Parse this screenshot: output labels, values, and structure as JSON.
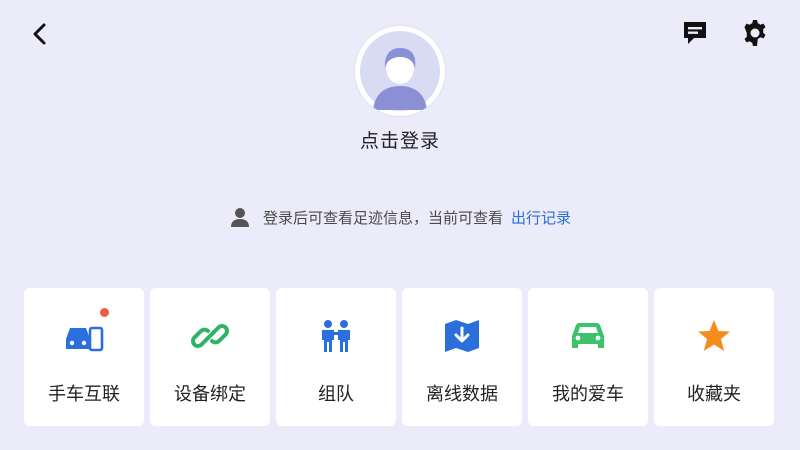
{
  "header": {
    "back_icon": "chevron-left-icon",
    "message_icon": "message-icon",
    "settings_icon": "gear-icon"
  },
  "profile": {
    "avatar_icon": "default-avatar-icon",
    "login_label": "点击登录"
  },
  "hint": {
    "icon": "person-icon",
    "text": "登录后可查看足迹信息，当前可查看",
    "link_label": "出行记录"
  },
  "features": [
    {
      "label": "手车互联",
      "icon": "phone-car-icon",
      "has_badge": true
    },
    {
      "label": "设备绑定",
      "icon": "link-icon",
      "has_badge": false
    },
    {
      "label": "组队",
      "icon": "team-icon",
      "has_badge": false
    },
    {
      "label": "离线数据",
      "icon": "offline-map-icon",
      "has_badge": false
    },
    {
      "label": "我的爱车",
      "icon": "car-icon",
      "has_badge": false
    },
    {
      "label": "收藏夹",
      "icon": "star-icon",
      "has_badge": false
    }
  ],
  "colors": {
    "background": "#ebebfa",
    "tile_background": "#ffffff",
    "accent_blue": "#2a6fdb",
    "link_green": "#2fb366",
    "car_green": "#3cc26a",
    "star_orange": "#f58c1f",
    "badge_red": "#f05a4a"
  }
}
